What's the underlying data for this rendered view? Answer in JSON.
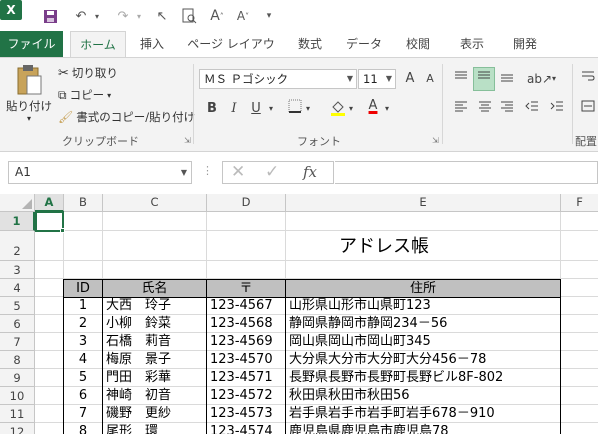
{
  "app": {
    "accent": "#217346"
  },
  "qat": {
    "items": [
      "excel-icon",
      "save-icon",
      "undo-icon",
      "redo-icon",
      "pointer-icon",
      "print-preview-icon",
      "font-increase-icon",
      "font-decrease-icon",
      "customize-icon"
    ]
  },
  "tabs": [
    "ファイル",
    "ホーム",
    "挿入",
    "ページ レイアウト",
    "数式",
    "データ",
    "校閲",
    "表示",
    "開発"
  ],
  "ribbon": {
    "clipboard": {
      "paste": "貼り付け",
      "cut": "切り取り",
      "copy": "コピー",
      "format_painter": "書式のコピー/貼り付け",
      "label": "クリップボード"
    },
    "font": {
      "name": "ＭＳ Ｐゴシック",
      "size": "11",
      "label": "フォント",
      "grow": "A",
      "shrink": "A",
      "bold": "B",
      "italic": "I",
      "underline": "U",
      "font_color": "A"
    },
    "alignment": {
      "label": "配置"
    }
  },
  "formula_bar": {
    "name_box": "A1",
    "fx": "fx",
    "value": ""
  },
  "sheet": {
    "columns": [
      "A",
      "B",
      "C",
      "D",
      "E",
      "F"
    ],
    "rows": [
      "1",
      "2",
      "3",
      "4",
      "5",
      "6",
      "7",
      "8",
      "9",
      "10",
      "11",
      "12"
    ],
    "title": "アドレス帳",
    "headers": [
      "ID",
      "氏名",
      "〒",
      "住所"
    ],
    "records": [
      [
        "1",
        "大西　玲子",
        "123-4567",
        "山形県山形市山県町123"
      ],
      [
        "2",
        "小柳　鈴菜",
        "123-4568",
        "静岡県静岡市静岡234－56"
      ],
      [
        "3",
        "石橋　莉音",
        "123-4569",
        "岡山県岡山市岡山町345"
      ],
      [
        "4",
        "梅原　景子",
        "123-4570",
        "大分県大分市大分町大分456－78"
      ],
      [
        "5",
        "門田　彩華",
        "123-4571",
        "長野県長野市長野町長野ビル8F-802"
      ],
      [
        "6",
        "神崎　初音",
        "123-4572",
        "秋田県秋田市秋田56"
      ],
      [
        "7",
        "磯野　更紗",
        "123-4573",
        "岩手県岩手市岩手町岩手678－910"
      ],
      [
        "8",
        "尾形　環",
        "123-4574",
        "鹿児島県鹿児島市鹿児島78"
      ]
    ]
  }
}
